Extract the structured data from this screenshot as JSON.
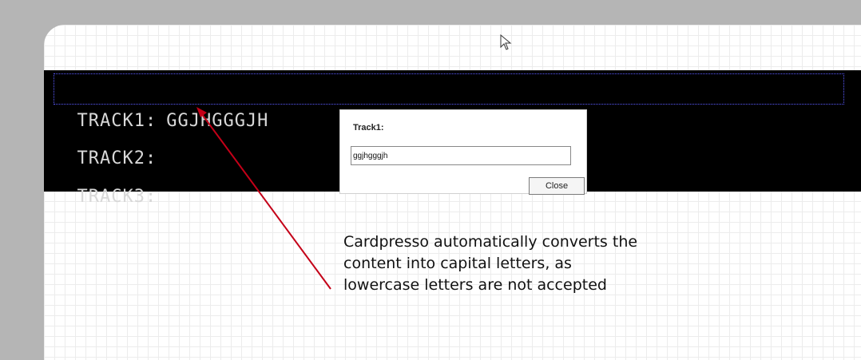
{
  "tracks": [
    {
      "label": "TRACK1:",
      "value": "GGJHGGGJH"
    },
    {
      "label": "TRACK2:",
      "value": ""
    },
    {
      "label": "TRACK3:",
      "value": ""
    }
  ],
  "dialog": {
    "title": "Track1:",
    "input_value": "ggjhgggjh",
    "close_label": "Close"
  },
  "annotation": {
    "text": "Cardpresso automatically converts the content into capital letters, as lowercase letters are not accepted"
  },
  "colors": {
    "arrow": "#c40018",
    "selection": "#5a5aff",
    "band": "#000000"
  },
  "icons": {
    "cursor": "mouse-pointer-icon",
    "arrow": "annotation-arrow-icon"
  }
}
